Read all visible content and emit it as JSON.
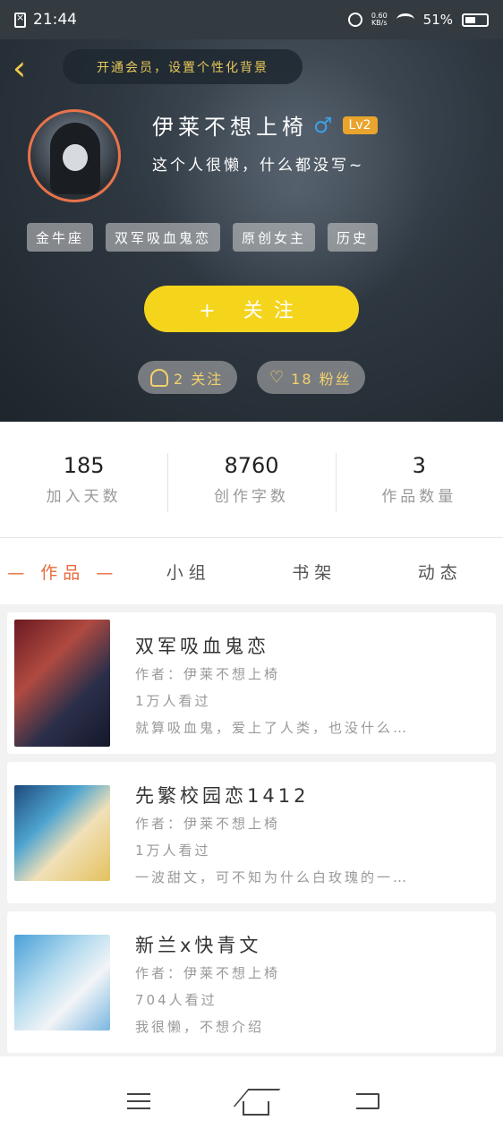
{
  "status_bar": {
    "time": "21:44",
    "speed": "0.60\nKB/s",
    "battery": "51%"
  },
  "header": {
    "back_icon": "chevron-left-icon",
    "vip_prompt": "开通会员，设置个性化背景"
  },
  "profile": {
    "name": "伊莱不想上椅",
    "gender_icon": "male-symbol-icon",
    "level": "Lv2",
    "bio": "这个人很懒，什么都没写~",
    "tags": [
      "金牛座",
      "双军吸血鬼恋",
      "原创女主",
      "历史"
    ],
    "follow_label": "+   关注",
    "following_count": "2 关注",
    "fans_count": "18 粉丝"
  },
  "stats": [
    {
      "value": "185",
      "label": "加入天数"
    },
    {
      "value": "8760",
      "label": "创作字数"
    },
    {
      "value": "3",
      "label": "作品数量"
    }
  ],
  "tabs": [
    "— 作品 —",
    "小组",
    "书架",
    "动态"
  ],
  "works": [
    {
      "title": "双军吸血鬼恋",
      "author": "作者：伊莱不想上椅",
      "views": "1万人看过",
      "summary": "就算吸血鬼，爱上了人类，也没什么…"
    },
    {
      "title": "先繁校园恋1412",
      "author": "作者：伊莱不想上椅",
      "views": "1万人看过",
      "summary": "一波甜文，可不知为什么白玫瑰的一…"
    },
    {
      "title": "新兰x快青文",
      "author": "作者：伊莱不想上椅",
      "views": "704人看过",
      "summary": "我很懒，不想介绍"
    }
  ],
  "colors": {
    "accent": "#e86a3c",
    "follow_button": "#f5d41c",
    "avatar_ring": "#e8734a",
    "gold_text": "#f3d16a"
  }
}
